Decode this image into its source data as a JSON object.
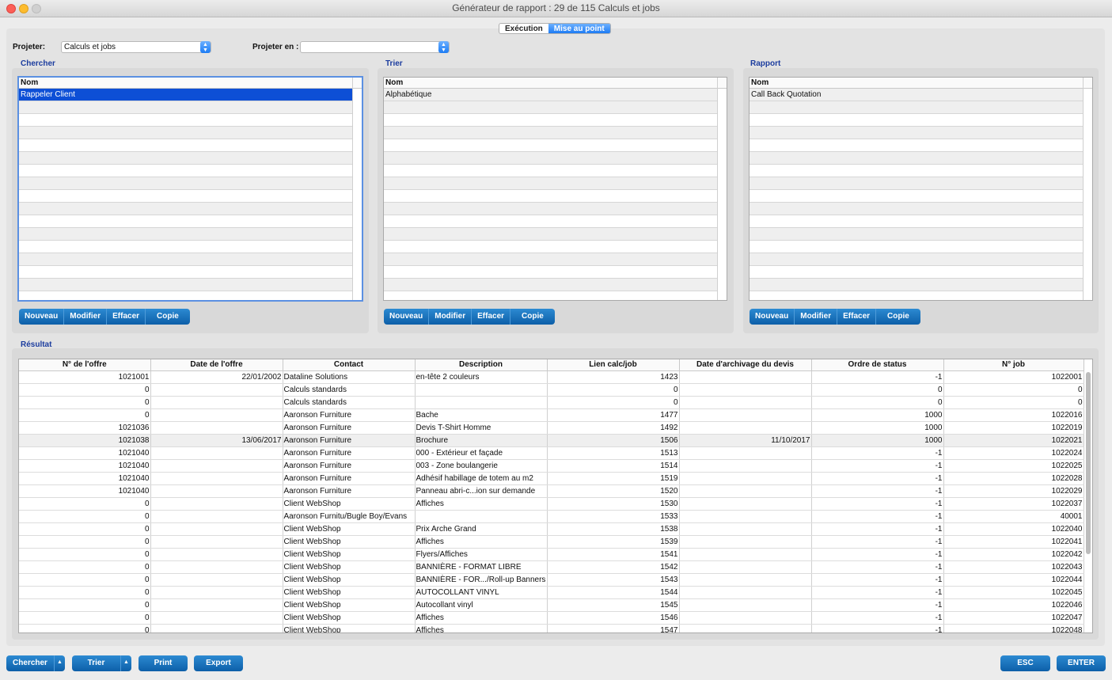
{
  "window": {
    "title": "Générateur de rapport : 29 de 115 Calculs et jobs"
  },
  "mode_tabs": [
    {
      "label": "Exécution"
    },
    {
      "label": "Mise au point"
    }
  ],
  "project": {
    "label": "Projeter:",
    "value": "Calculs et jobs",
    "to_label": "Projeter en :",
    "to_value": ""
  },
  "sections": {
    "search": {
      "title": "Chercher",
      "header": "Nom",
      "items": [
        "Rappeler Client"
      ],
      "buttons": [
        "Nouveau",
        "Modifier",
        "Effacer",
        "Copie"
      ]
    },
    "sort": {
      "title": "Trier",
      "header": "Nom",
      "items": [
        "Alphabétique"
      ],
      "buttons": [
        "Nouveau",
        "Modifier",
        "Effacer",
        "Copie"
      ]
    },
    "report": {
      "title": "Rapport",
      "header": "Nom",
      "items": [
        "Call Back Quotation"
      ],
      "buttons": [
        "Nouveau",
        "Modifier",
        "Effacer",
        "Copie"
      ]
    }
  },
  "result": {
    "title": "Résultat",
    "columns": [
      "N° de l'offre",
      "Date de l'offre",
      "Contact",
      "Description",
      "Lien calc/job",
      "Date d'archivage du devis",
      "Ordre de status",
      "N° job"
    ],
    "rows": [
      [
        "1021001",
        "22/01/2002",
        "Dataline Solutions",
        "en-tête 2 couleurs",
        "1423",
        "",
        "-1",
        "1022001"
      ],
      [
        "0",
        "",
        "Calculs standards",
        "",
        "0",
        "",
        "0",
        "0"
      ],
      [
        "0",
        "",
        "Calculs standards",
        "",
        "0",
        "",
        "0",
        "0"
      ],
      [
        "0",
        "",
        "Aaronson Furniture",
        "Bache",
        "1477",
        "",
        "1000",
        "1022016"
      ],
      [
        "1021036",
        "",
        "Aaronson Furniture",
        "Devis T-Shirt Homme",
        "1492",
        "",
        "1000",
        "1022019"
      ],
      [
        "1021038",
        "13/06/2017",
        "Aaronson Furniture",
        "Brochure",
        "1506",
        "11/10/2017",
        "1000",
        "1022021"
      ],
      [
        "1021040",
        "",
        "Aaronson Furniture",
        "000 - Extérieur et façade",
        "1513",
        "",
        "-1",
        "1022024"
      ],
      [
        "1021040",
        "",
        "Aaronson Furniture",
        "003 - Zone boulangerie",
        "1514",
        "",
        "-1",
        "1022025"
      ],
      [
        "1021040",
        "",
        "Aaronson Furniture",
        "Adhésif habillage de totem au m2",
        "1519",
        "",
        "-1",
        "1022028"
      ],
      [
        "1021040",
        "",
        "Aaronson Furniture",
        "Panneau abri-c...ion sur demande",
        "1520",
        "",
        "-1",
        "1022029"
      ],
      [
        "0",
        "",
        "Client WebShop",
        "Affiches",
        "1530",
        "",
        "-1",
        "1022037"
      ],
      [
        "0",
        "",
        "Aaronson Furnitu/Bugle Boy/Evans",
        "",
        "1533",
        "",
        "-1",
        "40001"
      ],
      [
        "0",
        "",
        "Client WebShop",
        "Prix Arche Grand",
        "1538",
        "",
        "-1",
        "1022040"
      ],
      [
        "0",
        "",
        "Client WebShop",
        "Affiches",
        "1539",
        "",
        "-1",
        "1022041"
      ],
      [
        "0",
        "",
        "Client WebShop",
        "Flyers/Affiches",
        "1541",
        "",
        "-1",
        "1022042"
      ],
      [
        "0",
        "",
        "Client WebShop",
        "BANNIÈRE - FORMAT LIBRE",
        "1542",
        "",
        "-1",
        "1022043"
      ],
      [
        "0",
        "",
        "Client WebShop",
        "BANNIÈRE - FOR.../Roll-up Banners",
        "1543",
        "",
        "-1",
        "1022044"
      ],
      [
        "0",
        "",
        "Client WebShop",
        "AUTOCOLLANT VINYL",
        "1544",
        "",
        "-1",
        "1022045"
      ],
      [
        "0",
        "",
        "Client WebShop",
        "Autocollant vinyl",
        "1545",
        "",
        "-1",
        "1022046"
      ],
      [
        "0",
        "",
        "Client WebShop",
        "Affiches",
        "1546",
        "",
        "-1",
        "1022047"
      ],
      [
        "0",
        "",
        "Client WebShop",
        "Affiches",
        "1547",
        "",
        "-1",
        "1022048"
      ]
    ]
  },
  "footer": {
    "search_label": "Chercher",
    "sort_label": "Trier",
    "print_label": "Print",
    "export_label": "Export",
    "esc_label": "ESC",
    "enter_label": "ENTER"
  },
  "icons": {
    "caret": "▲",
    "combo_arrow": "chevron-updown-icon"
  },
  "colors": {
    "accent": "#1d7cf4",
    "button": "#0d5fa8",
    "selection": "#0d4fd6",
    "section_title": "#1b3c9e"
  }
}
